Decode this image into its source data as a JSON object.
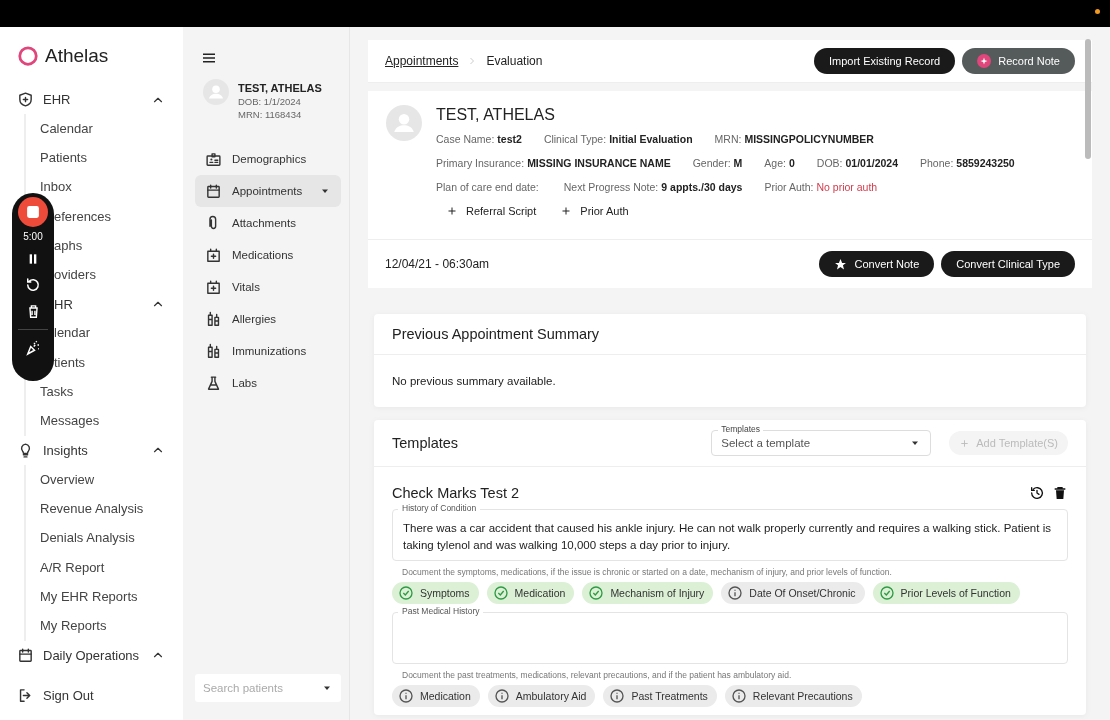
{
  "recorder": {
    "time": "5:00"
  },
  "sidebar": {
    "logo": "Athelas",
    "groups": [
      {
        "label": "EHR",
        "expanded": true,
        "items": [
          {
            "label": "Calendar"
          },
          {
            "label": "Patients"
          },
          {
            "label": "Inbox"
          },
          {
            "label": "eferences",
            "clipped": true
          },
          {
            "label": "aphs",
            "clipped": true
          },
          {
            "label": "oviders",
            "clipped": true
          }
        ]
      },
      {
        "label": "HR",
        "clipped": true,
        "expanded": true,
        "items": [
          {
            "label": "lendar",
            "clipped": true
          },
          {
            "label": "tients",
            "clipped": true
          },
          {
            "label": "Tasks"
          },
          {
            "label": "Messages"
          }
        ]
      },
      {
        "label": "Insights",
        "expanded": true,
        "items": [
          {
            "label": "Overview"
          },
          {
            "label": "Revenue Analysis"
          },
          {
            "label": "Denials Analysis"
          },
          {
            "label": "A/R Report"
          },
          {
            "label": "My EHR Reports"
          },
          {
            "label": "My Reports"
          }
        ]
      },
      {
        "label": "Daily Operations",
        "expanded": true
      }
    ],
    "sign_out": "Sign Out"
  },
  "patient_panel": {
    "name": "TEST, ATHELAS",
    "dob": "DOB: 1/1/2024",
    "mrn": "MRN: 1168434",
    "menu": [
      {
        "label": "Demographics",
        "selected": false,
        "dropdown": false
      },
      {
        "label": "Appointments",
        "selected": true,
        "dropdown": true
      },
      {
        "label": "Attachments",
        "selected": false,
        "dropdown": false
      },
      {
        "label": "Medications",
        "selected": false,
        "dropdown": false
      },
      {
        "label": "Vitals",
        "selected": false,
        "dropdown": false
      },
      {
        "label": "Allergies",
        "selected": false,
        "dropdown": false
      },
      {
        "label": "Immunizations",
        "selected": false,
        "dropdown": false
      },
      {
        "label": "Labs",
        "selected": false,
        "dropdown": false
      }
    ],
    "search": {
      "placeholder": "Search patients"
    }
  },
  "header": {
    "breadcrumb": [
      {
        "label": "Appointments",
        "link": true
      },
      {
        "label": "Evaluation",
        "link": false
      }
    ],
    "buttons": [
      {
        "label": "Import Existing Record",
        "kind": "dark"
      },
      {
        "label": "Record Note",
        "kind": "record"
      }
    ]
  },
  "patient": {
    "name": "TEST, ATHELAS",
    "rows": [
      [
        {
          "label": "Case Name:",
          "value": "test2",
          "alert": false
        },
        {
          "label": "Clinical Type:",
          "value": "Initial Evaluation",
          "alert": false
        },
        {
          "label": "MRN:",
          "value": "MISSINGPOLICYNUMBER",
          "alert": false
        }
      ],
      [
        {
          "label": "Primary Insurance:",
          "value": "MISSING INSURANCE NAME",
          "alert": false
        },
        {
          "label": "Gender:",
          "value": "M",
          "alert": false
        },
        {
          "label": "Age:",
          "value": "0",
          "alert": false
        },
        {
          "label": "DOB:",
          "value": "01/01/2024",
          "alert": false
        },
        {
          "label": "Phone:",
          "value": "5859243250",
          "alert": false
        }
      ],
      [
        {
          "label": "Plan of care end date:"
        },
        {
          "label": "Next Progress Note:",
          "value": "9 appts./30 days",
          "alert": false
        },
        {
          "label": "Prior Auth:",
          "value": "No prior auth",
          "alert": true
        }
      ]
    ],
    "actions": [
      "Referral Script",
      "Prior Auth"
    ]
  },
  "appointment": {
    "date": "12/04/21 - 06:30am",
    "buttons": [
      {
        "label": "Convert Note"
      },
      {
        "label": "Convert Clinical Type"
      }
    ]
  },
  "summary": {
    "title": "Previous Appointment Summary",
    "text": "No previous summary available."
  },
  "templates": {
    "title": "Templates",
    "select": {
      "label": "Templates",
      "placeholder": "Select a template"
    },
    "add_button": {
      "label": "Add Template(S)",
      "disabled": true
    },
    "template": {
      "title": "Check Marks Test 2",
      "sections": [
        {
          "label": "History of Condition",
          "value": "There was a car accident that caused his ankle injury. He can not walk properly currently and requires a walking stick. Patient is taking tylenol and was walking 10,000 steps a day prior to injury.",
          "hint": "Document the symptoms, medications, if the issue is chronic or started on a date, mechanism of injury, and prior levels of function.",
          "chips": [
            {
              "label": "Symptoms",
              "checked": true
            },
            {
              "label": "Medication",
              "checked": true
            },
            {
              "label": "Mechanism of Injury",
              "checked": true
            },
            {
              "label": "Date Of Onset/Chronic",
              "checked": false
            },
            {
              "label": "Prior Levels of Function",
              "checked": true
            }
          ]
        },
        {
          "label": "Past Medical History",
          "hint": "Document the past treatments, medications, relevant precautions, and if the patient has ambulatory aid.",
          "chips": [
            {
              "label": "Medication",
              "checked": false
            },
            {
              "label": "Ambulatory Aid",
              "checked": false
            },
            {
              "label": "Past Treatments",
              "checked": false
            },
            {
              "label": "Relevant Precautions",
              "checked": false
            }
          ]
        }
      ]
    }
  }
}
